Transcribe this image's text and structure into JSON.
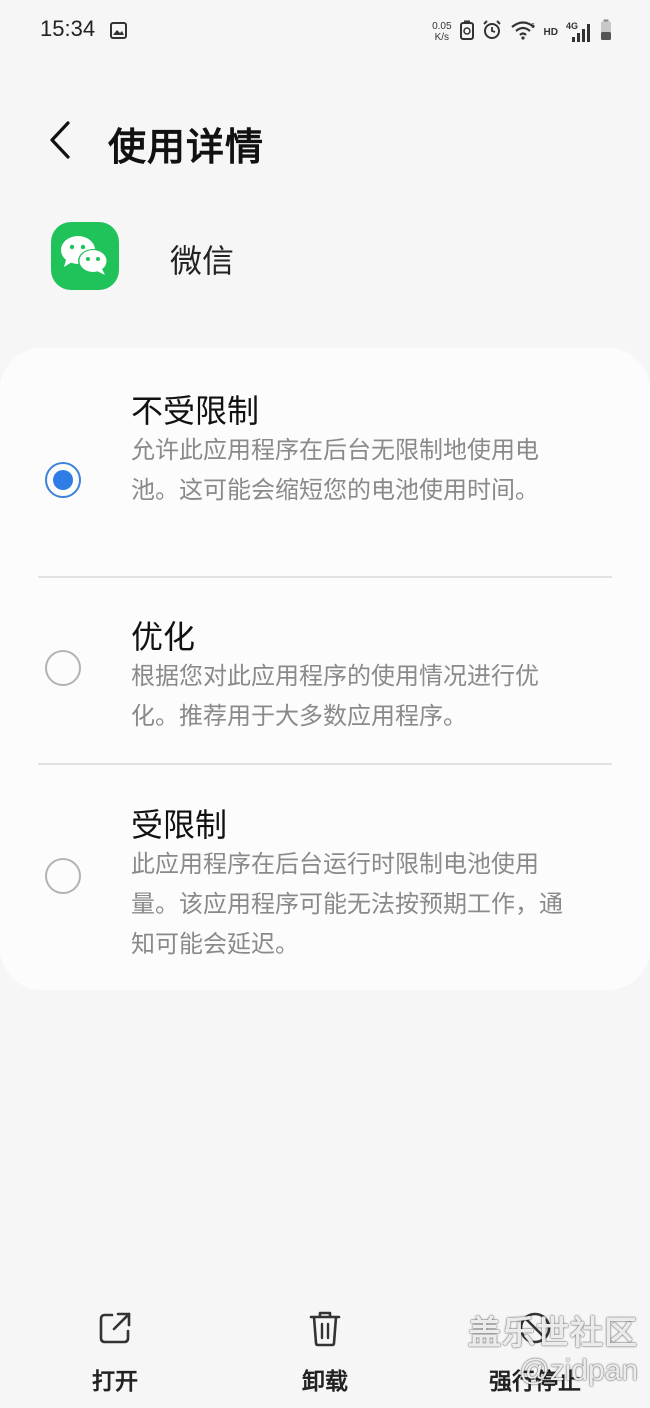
{
  "status_bar": {
    "time": "15:34",
    "net_speed_value": "0.05",
    "net_speed_unit": "K/s",
    "hd_label": "HD",
    "network_label": "4G",
    "left_icon": "image-icon",
    "icons": [
      "recycle-battery-icon",
      "alarm-icon",
      "wifi-icon",
      "signal-icon",
      "battery-icon"
    ]
  },
  "header": {
    "back_icon": "chevron-left-icon",
    "title": "使用详情"
  },
  "app": {
    "name": "微信",
    "icon": "wechat-icon",
    "icon_color": "#20c35a"
  },
  "options": [
    {
      "title": "不受限制",
      "description": "允许此应用程序在后台无限制地使用电池。这可能会缩短您的电池使用时间。",
      "selected": true
    },
    {
      "title": "优化",
      "description": "根据您对此应用程序的使用情况进行优化。推荐用于大多数应用程序。",
      "selected": false
    },
    {
      "title": "受限制",
      "description": "此应用程序在后台运行时限制电池使用量。该应用程序可能无法按预期工作，通知可能会延迟。",
      "selected": false
    }
  ],
  "bottom_bar": {
    "open_label": "打开",
    "uninstall_label": "卸载",
    "force_stop_label": "强行停止"
  },
  "watermark": {
    "line1": "盖乐世社区",
    "line2": "@zidpan"
  },
  "colors": {
    "accent": "#2f7ce6",
    "background": "#f6f6f6",
    "card": "#fcfcfc"
  }
}
